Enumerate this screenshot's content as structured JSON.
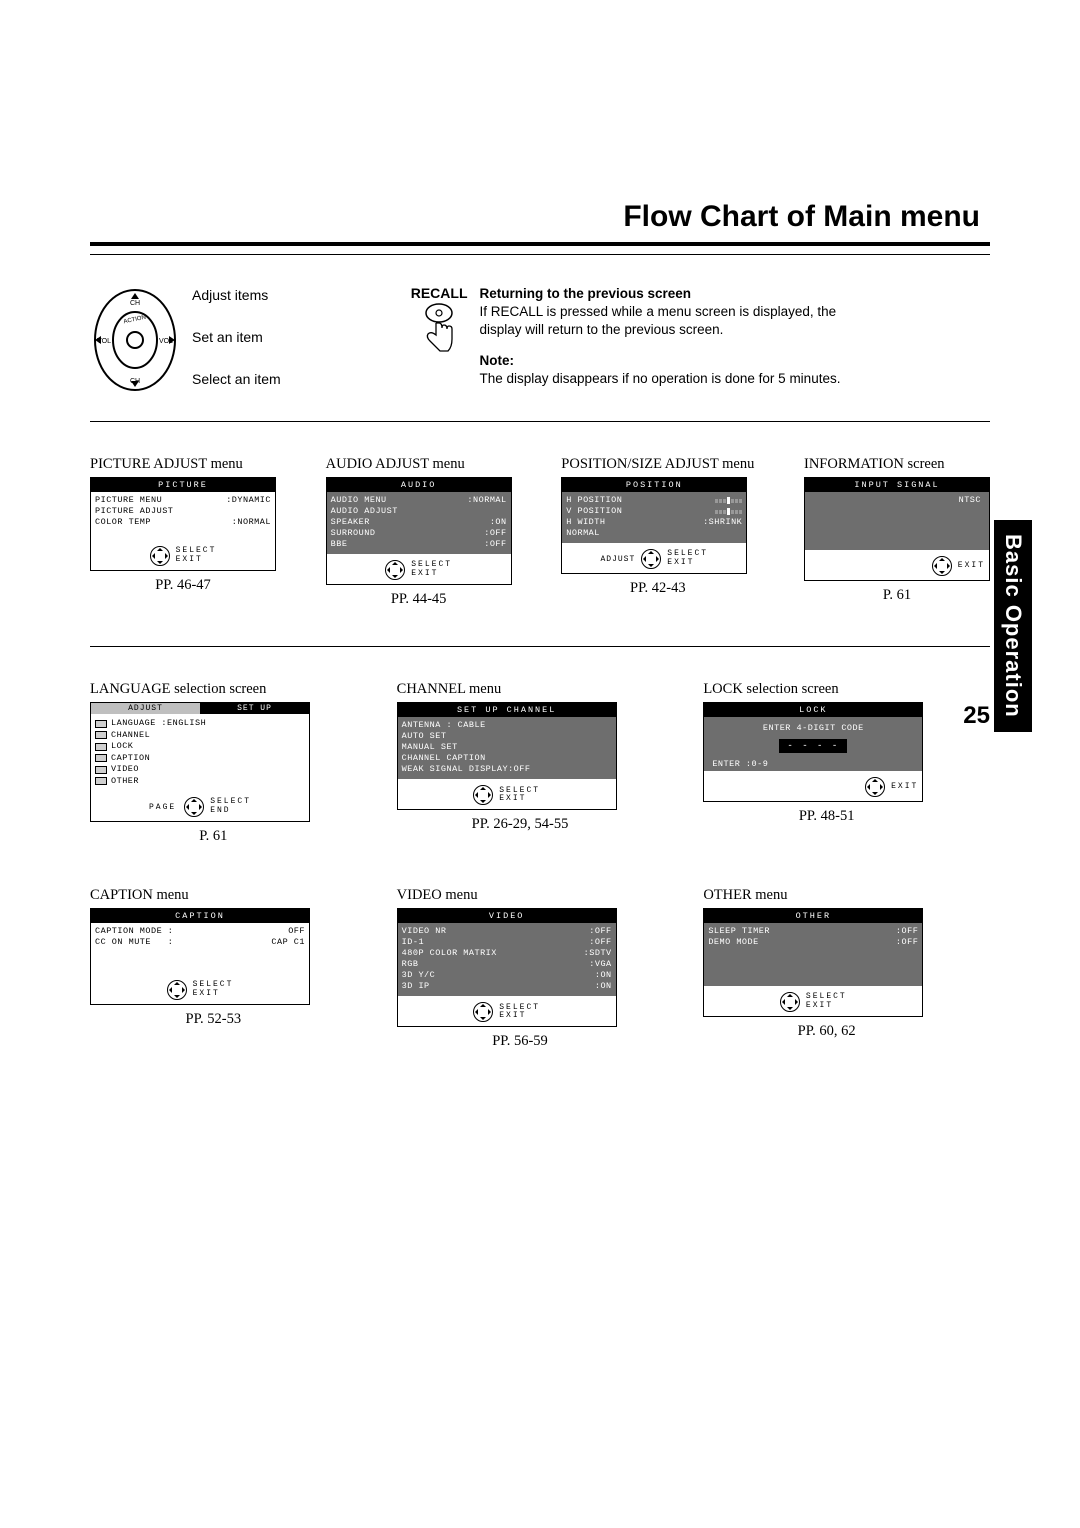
{
  "title": "Flow Chart of Main menu",
  "sectionTab": "Basic Operation",
  "pageNumber": "25",
  "remote": {
    "adjust": "Adjust items",
    "set": "Set an item",
    "select": "Select an item"
  },
  "recall": {
    "label": "RECALL",
    "heading": "Returning to the previous screen",
    "body": "If RECALL is pressed while a menu screen is displayed, the display will return to the previous screen."
  },
  "note": {
    "heading": "Note:",
    "body": "The display disappears if no operation is done for 5 minutes."
  },
  "footers": {
    "select": "SELECT",
    "exit": "EXIT",
    "end": "END",
    "page": "PAGE",
    "adjust": "ADJUST"
  },
  "menusRow1": {
    "picture": {
      "caption": "PICTURE ADJUST menu",
      "title": "PICTURE",
      "rows": [
        [
          "PICTURE MENU",
          ":DYNAMIC"
        ],
        [
          "PICTURE ADJUST",
          ""
        ],
        [
          "COLOR TEMP",
          ":NORMAL"
        ]
      ],
      "pp": "PP. 46-47"
    },
    "audio": {
      "caption": "AUDIO ADJUST menu",
      "title": "AUDIO",
      "rows": [
        [
          "AUDIO MENU",
          ":NORMAL"
        ],
        [
          "AUDIO ADJUST",
          ""
        ],
        [
          "SPEAKER",
          ":ON"
        ],
        [
          "SURROUND",
          ":OFF"
        ],
        [
          "BBE",
          ":OFF"
        ]
      ],
      "pp": "PP. 44-45"
    },
    "position": {
      "caption": "POSITION/SIZE ADJUST menu",
      "title": "POSITION",
      "rows": [
        [
          "H POSITION",
          "bars"
        ],
        [
          "V POSITION",
          "bars"
        ],
        [
          "H WIDTH",
          ":SHRINK"
        ],
        [
          "NORMAL",
          ""
        ]
      ],
      "pp": "PP. 42-43"
    },
    "info": {
      "caption": "INFORMATION screen",
      "title": "INPUT SIGNAL",
      "signal": "NTSC",
      "pp": "P. 61"
    }
  },
  "menusRow2": {
    "language": {
      "caption": "LANGUAGE selection screen",
      "tabs": [
        "ADJUST",
        "SET UP"
      ],
      "items": [
        "LANGUAGE :ENGLISH",
        "CHANNEL",
        "LOCK",
        "CAPTION",
        "VIDEO",
        "OTHER"
      ],
      "pp": "P. 61"
    },
    "channel": {
      "caption": "CHANNEL menu",
      "title": "SET UP CHANNEL",
      "rows": [
        "ANTENNA : CABLE",
        "AUTO SET",
        "MANUAL SET",
        "CHANNEL CAPTION",
        "WEAK SIGNAL DISPLAY:OFF"
      ],
      "pp": "PP. 26-29, 54-55"
    },
    "lock": {
      "caption": "LOCK selection screen",
      "title": "LOCK",
      "prompt": "ENTER 4-DIGIT CODE",
      "digits": "- - - -",
      "enter": "ENTER :0-9",
      "pp": "PP. 48-51"
    },
    "caption_menu": {
      "caption": "CAPTION menu",
      "title": "CAPTION",
      "rows": [
        [
          "CAPTION MODE :",
          "OFF"
        ],
        [
          "CC ON MUTE   :",
          "CAP C1"
        ]
      ],
      "pp": "PP. 52-53"
    },
    "video": {
      "caption": "VIDEO menu",
      "title": "VIDEO",
      "rows": [
        [
          "VIDEO NR",
          ":OFF"
        ],
        [
          "ID-1",
          ":OFF"
        ],
        [
          "480P COLOR MATRIX",
          ":SDTV"
        ],
        [
          "RGB",
          ":VGA"
        ],
        [
          "3D Y/C",
          ":ON"
        ],
        [
          "3D IP",
          ":ON"
        ]
      ],
      "pp": "PP. 56-59"
    },
    "other": {
      "caption": "OTHER menu",
      "title": "OTHER",
      "rows": [
        [
          "SLEEP TIMER",
          ":OFF"
        ],
        [
          "DEMO MODE",
          ":OFF"
        ]
      ],
      "pp": "PP. 60, 62"
    }
  }
}
